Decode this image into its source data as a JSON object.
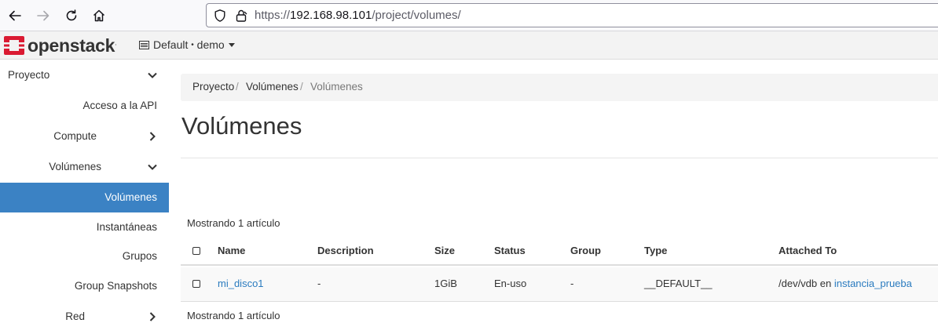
{
  "browser": {
    "url_prefix": "https://",
    "url_host": "192.168.98.101",
    "url_path": "/project/volumes/"
  },
  "header": {
    "logo_text": "openstack",
    "logo_mark": ".",
    "domain": "Default",
    "separator": "•",
    "project": "demo",
    "brand_color": "#da1a32"
  },
  "sidebar": {
    "items": [
      {
        "label": "Proyecto",
        "icon": "chevron-down-icon"
      },
      {
        "label": "Acceso a la API"
      },
      {
        "label": "Compute",
        "icon": "chevron-right-icon"
      },
      {
        "label": "Volúmenes",
        "icon": "chevron-down-icon"
      },
      {
        "label": "Volúmenes",
        "active": true
      },
      {
        "label": "Instantáneas"
      },
      {
        "label": "Grupos"
      },
      {
        "label": "Group Snapshots"
      },
      {
        "label": "Red",
        "icon": "chevron-right-icon"
      }
    ],
    "active_color": "#3b82c4"
  },
  "breadcrumb": {
    "items": [
      "Proyecto",
      "Volúmenes",
      "Volúmenes"
    ],
    "separator": "/"
  },
  "page": {
    "title": "Volúmenes",
    "count_top": "Mostrando 1 artículo",
    "count_bottom": "Mostrando 1 artículo"
  },
  "table": {
    "columns": [
      "Name",
      "Description",
      "Size",
      "Status",
      "Group",
      "Type",
      "Attached To"
    ],
    "rows": [
      {
        "name": "mi_disco1",
        "description": "-",
        "size": "1GiB",
        "status": "En-uso",
        "group": "-",
        "type": "__DEFAULT__",
        "attached_prefix": "/dev/vdb en",
        "attached_instance": "instancia_prueba"
      }
    ]
  }
}
